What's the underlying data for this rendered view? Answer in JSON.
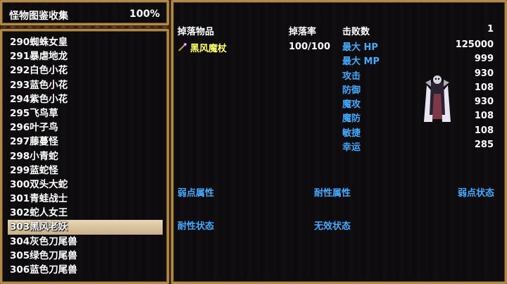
{
  "header": {
    "title": "怪物图鉴收集",
    "percent": "100%"
  },
  "list": [
    "290蜘蛛女皇",
    "291暴虐地龙",
    "292白色小花",
    "293蓝色小花",
    "294紫色小花",
    "295飞鸟草",
    "296叶子鸟",
    "297藤蔓怪",
    "298小青蛇",
    "299蓝蛇怪",
    "300双头大蛇",
    "301青蛙战士",
    "302蛇人女王",
    "303黑风老妖",
    "304灰色刀尾兽",
    "305绿色刀尾兽",
    "306蓝色刀尾兽"
  ],
  "selected_index": 13,
  "detail": {
    "drop_item_header": "掉落物品",
    "drop_rate_header": "掉落率",
    "defeat_header": "击败数",
    "defeat_count": "1",
    "item": {
      "icon": "staff-icon",
      "name": "黑风魔杖",
      "rate": "100/100"
    },
    "stats": [
      {
        "label": "最大 HP",
        "value": "125000"
      },
      {
        "label": "最大 MP",
        "value": "999"
      },
      {
        "label": "攻击",
        "value": "930"
      },
      {
        "label": "防御",
        "value": "108"
      },
      {
        "label": "魔攻",
        "value": "930"
      },
      {
        "label": "魔防",
        "value": "108"
      },
      {
        "label": "敏捷",
        "value": "108"
      },
      {
        "label": "幸运",
        "value": "285"
      }
    ],
    "weak_attr": "弱点属性",
    "resist_attr": "耐性属性",
    "weak_state": "弱点状态",
    "resist_state": "耐性状态",
    "immune_state": "无效状态"
  },
  "colors": {
    "label_blue": "#44aaff",
    "item_yellow": "#ffff66",
    "border_gold": "#b08a4a"
  }
}
